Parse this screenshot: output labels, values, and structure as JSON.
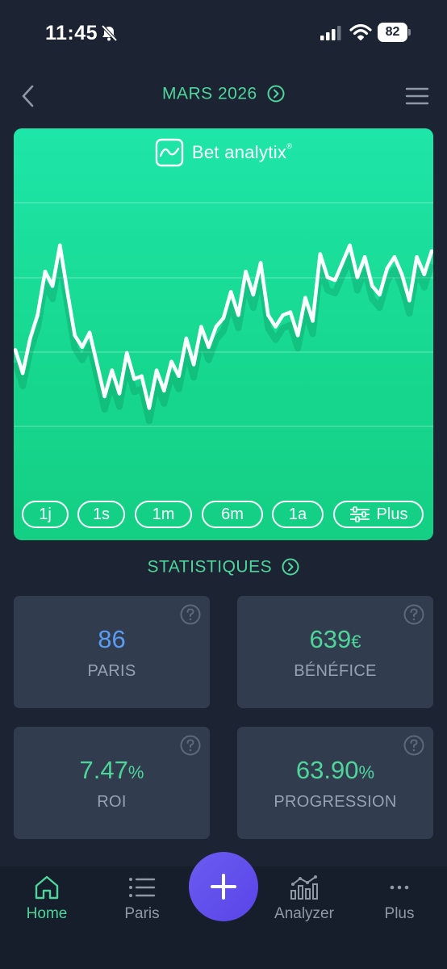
{
  "status_bar": {
    "time": "11:45",
    "battery": "82"
  },
  "header": {
    "title": "MARS 2026"
  },
  "brand": {
    "name": "Bet analytix",
    "mark": "®"
  },
  "chart_data": {
    "type": "line",
    "title": "",
    "xlabel": "",
    "ylabel": "",
    "grid": true,
    "x": [
      0,
      1,
      2,
      3,
      4,
      5,
      6,
      7,
      8,
      9,
      10,
      11,
      12,
      13,
      14,
      15,
      16,
      17,
      18,
      19,
      20,
      21,
      22,
      23,
      24,
      25,
      26,
      27,
      28,
      29,
      30,
      31,
      32,
      33,
      34,
      35,
      36,
      37,
      38,
      39,
      40,
      41,
      42,
      43,
      44,
      45,
      46,
      47,
      48,
      49,
      50,
      51,
      52,
      53,
      54,
      55,
      56
    ],
    "y": [
      46,
      38,
      50,
      58,
      73,
      68,
      82,
      66,
      51,
      47,
      52,
      41,
      30,
      39,
      31,
      45,
      36,
      37,
      26,
      39,
      32,
      42,
      37,
      50,
      41,
      54,
      47,
      54,
      57,
      66,
      58,
      73,
      65,
      76,
      58,
      54,
      58,
      59,
      51,
      64,
      56,
      79,
      71,
      70,
      76,
      82,
      71,
      78,
      68,
      65,
      74,
      78,
      72,
      63,
      78,
      72,
      80
    ],
    "color": "#ffffff"
  },
  "ranges": [
    "1j",
    "1s",
    "1m",
    "6m",
    "1a",
    "Plus"
  ],
  "section": {
    "title": "STATISTIQUES"
  },
  "stats": [
    {
      "value": "86",
      "unit": "",
      "label": "PARIS",
      "color": "#5b9cf0"
    },
    {
      "value": "639",
      "unit": "€",
      "label": "BÉNÉFICE",
      "color": "#4fd49a"
    },
    {
      "value": "7.47",
      "unit": "%",
      "label": "ROI",
      "color": "#4fd49a"
    },
    {
      "value": "63.90",
      "unit": "%",
      "label": "PROGRESSION",
      "color": "#4fd49a"
    }
  ],
  "nav": [
    {
      "label": "Home",
      "icon": "home-icon",
      "active": true
    },
    {
      "label": "Paris",
      "icon": "list-icon",
      "active": false
    },
    {
      "label": "Analyzer",
      "icon": "analytics-icon",
      "active": false
    },
    {
      "label": "Plus",
      "icon": "more-icon",
      "active": false
    }
  ],
  "colors": {
    "accent": "#4fd49a",
    "background": "#1c2433",
    "card": "#313d4f",
    "fab": "#5a44e8"
  }
}
